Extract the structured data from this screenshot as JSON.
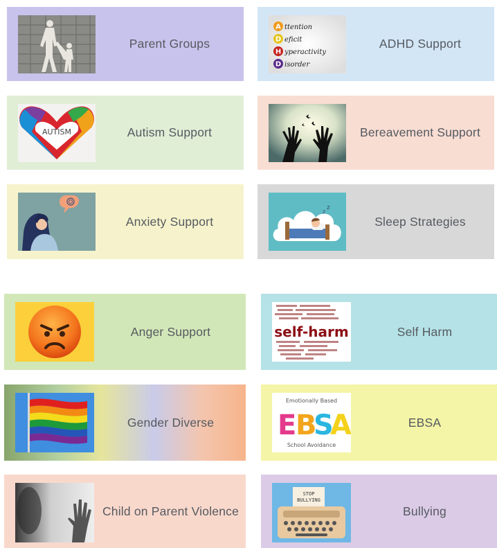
{
  "tiles": [
    {
      "id": "parent-groups",
      "label": "Parent Groups",
      "image_alt": "parent and child walking"
    },
    {
      "id": "adhd-support",
      "label": "ADHD Support",
      "image_alt": "ADHD acronym",
      "image_text": {
        "a": "ttention",
        "d": "eficit",
        "h": "yperactivity",
        "d2": "isorder"
      }
    },
    {
      "id": "autism-support",
      "label": "Autism Support",
      "image_alt": "puzzle heart hands",
      "image_text": "AUTISM"
    },
    {
      "id": "bereavement-support",
      "label": "Bereavement Support",
      "image_alt": "hands reaching to sky with butterflies"
    },
    {
      "id": "anxiety-support",
      "label": "Anxiety Support",
      "image_alt": "worried person with thought bubble"
    },
    {
      "id": "sleep-strategies",
      "label": "Sleep Strategies",
      "image_alt": "child sleeping in bed"
    },
    {
      "id": "anger-support",
      "label": "Anger Support",
      "image_alt": "angry face emoji"
    },
    {
      "id": "self-harm",
      "label": "Self Harm",
      "image_alt": "self-harm word cloud",
      "image_text": "self-harm"
    },
    {
      "id": "gender-diverse",
      "label": "Gender Diverse",
      "image_alt": "rainbow flag"
    },
    {
      "id": "ebsa",
      "label": "EBSA",
      "image_alt": "EBSA logo",
      "image_text": {
        "top": "Emotionally Based",
        "main": "EBSA",
        "bottom": "School Avoidance"
      }
    },
    {
      "id": "child-on-parent-violence",
      "label": "Child on Parent Violence",
      "image_alt": "hand behind frosted glass"
    },
    {
      "id": "bullying",
      "label": "Bullying",
      "image_alt": "stop bullying typewriter",
      "image_text": "STOP BULLYING"
    }
  ],
  "colors": {
    "label_text": "#555a60",
    "parent": "#c8c3ec",
    "adhd": "#d3e6f6",
    "autism": "#e1eed6",
    "bereavement": "#f8ddd3",
    "anxiety": "#f6f3cc",
    "sleep": "#d8d8d8",
    "anger": "#d2e7b8",
    "selfharm": "#b5e2e6",
    "ebsa": "#f4f5a6",
    "cpv": "#f9d8cc",
    "bullying": "#dccbe6"
  }
}
